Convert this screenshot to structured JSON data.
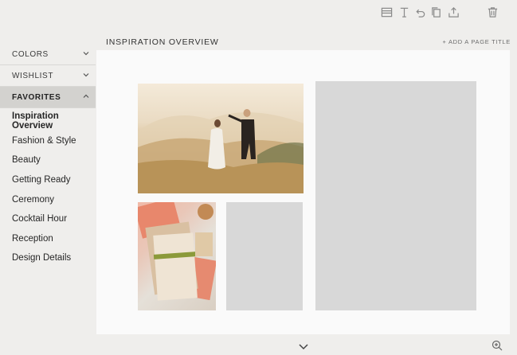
{
  "toolbar": {
    "icons": [
      "layout-icon",
      "text-icon",
      "undo-icon",
      "copy-icon",
      "share-icon",
      "trash-icon"
    ]
  },
  "sidebar": {
    "sections": [
      {
        "label": "COLORS"
      },
      {
        "label": "WISHLIST"
      },
      {
        "label": "FAVORITES"
      }
    ],
    "items": [
      {
        "label": "Inspiration Overview"
      },
      {
        "label": "Fashion & Style"
      },
      {
        "label": "Beauty"
      },
      {
        "label": "Getting Ready"
      },
      {
        "label": "Ceremony"
      },
      {
        "label": "Cocktail Hour"
      },
      {
        "label": "Reception"
      },
      {
        "label": "Design Details"
      }
    ]
  },
  "header": {
    "page_title": "INSPIRATION OVERVIEW",
    "add_page_title": "+ ADD A PAGE TITLE"
  },
  "colors": {
    "background": "#efeeec",
    "canvas": "#fafafa",
    "placeholder": "#d8d8d8",
    "active_section": "#d3d2cf"
  }
}
